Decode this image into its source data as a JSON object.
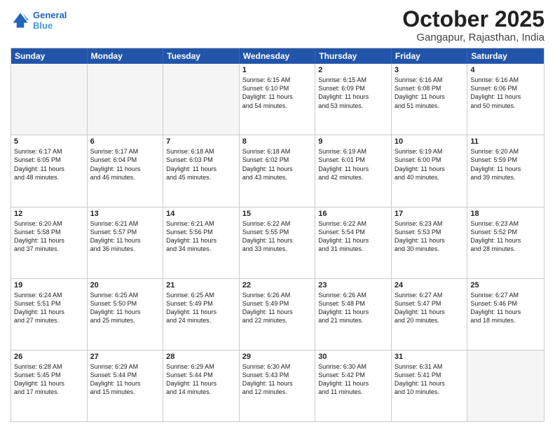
{
  "logo": {
    "line1": "General",
    "line2": "Blue"
  },
  "title": "October 2025",
  "location": "Gangapur, Rajasthan, India",
  "days_header": [
    "Sunday",
    "Monday",
    "Tuesday",
    "Wednesday",
    "Thursday",
    "Friday",
    "Saturday"
  ],
  "weeks": [
    [
      {
        "day": "",
        "info": ""
      },
      {
        "day": "",
        "info": ""
      },
      {
        "day": "",
        "info": ""
      },
      {
        "day": "1",
        "info": "Sunrise: 6:15 AM\nSunset: 6:10 PM\nDaylight: 11 hours\nand 54 minutes."
      },
      {
        "day": "2",
        "info": "Sunrise: 6:15 AM\nSunset: 6:09 PM\nDaylight: 11 hours\nand 53 minutes."
      },
      {
        "day": "3",
        "info": "Sunrise: 6:16 AM\nSunset: 6:08 PM\nDaylight: 11 hours\nand 51 minutes."
      },
      {
        "day": "4",
        "info": "Sunrise: 6:16 AM\nSunset: 6:06 PM\nDaylight: 11 hours\nand 50 minutes."
      }
    ],
    [
      {
        "day": "5",
        "info": "Sunrise: 6:17 AM\nSunset: 6:05 PM\nDaylight: 11 hours\nand 48 minutes."
      },
      {
        "day": "6",
        "info": "Sunrise: 6:17 AM\nSunset: 6:04 PM\nDaylight: 11 hours\nand 46 minutes."
      },
      {
        "day": "7",
        "info": "Sunrise: 6:18 AM\nSunset: 6:03 PM\nDaylight: 11 hours\nand 45 minutes."
      },
      {
        "day": "8",
        "info": "Sunrise: 6:18 AM\nSunset: 6:02 PM\nDaylight: 11 hours\nand 43 minutes."
      },
      {
        "day": "9",
        "info": "Sunrise: 6:19 AM\nSunset: 6:01 PM\nDaylight: 11 hours\nand 42 minutes."
      },
      {
        "day": "10",
        "info": "Sunrise: 6:19 AM\nSunset: 6:00 PM\nDaylight: 11 hours\nand 40 minutes."
      },
      {
        "day": "11",
        "info": "Sunrise: 6:20 AM\nSunset: 5:59 PM\nDaylight: 11 hours\nand 39 minutes."
      }
    ],
    [
      {
        "day": "12",
        "info": "Sunrise: 6:20 AM\nSunset: 5:58 PM\nDaylight: 11 hours\nand 37 minutes."
      },
      {
        "day": "13",
        "info": "Sunrise: 6:21 AM\nSunset: 5:57 PM\nDaylight: 11 hours\nand 36 minutes."
      },
      {
        "day": "14",
        "info": "Sunrise: 6:21 AM\nSunset: 5:56 PM\nDaylight: 11 hours\nand 34 minutes."
      },
      {
        "day": "15",
        "info": "Sunrise: 6:22 AM\nSunset: 5:55 PM\nDaylight: 11 hours\nand 33 minutes."
      },
      {
        "day": "16",
        "info": "Sunrise: 6:22 AM\nSunset: 5:54 PM\nDaylight: 11 hours\nand 31 minutes."
      },
      {
        "day": "17",
        "info": "Sunrise: 6:23 AM\nSunset: 5:53 PM\nDaylight: 11 hours\nand 30 minutes."
      },
      {
        "day": "18",
        "info": "Sunrise: 6:23 AM\nSunset: 5:52 PM\nDaylight: 11 hours\nand 28 minutes."
      }
    ],
    [
      {
        "day": "19",
        "info": "Sunrise: 6:24 AM\nSunset: 5:51 PM\nDaylight: 11 hours\nand 27 minutes."
      },
      {
        "day": "20",
        "info": "Sunrise: 6:25 AM\nSunset: 5:50 PM\nDaylight: 11 hours\nand 25 minutes."
      },
      {
        "day": "21",
        "info": "Sunrise: 6:25 AM\nSunset: 5:49 PM\nDaylight: 11 hours\nand 24 minutes."
      },
      {
        "day": "22",
        "info": "Sunrise: 6:26 AM\nSunset: 5:49 PM\nDaylight: 11 hours\nand 22 minutes."
      },
      {
        "day": "23",
        "info": "Sunrise: 6:26 AM\nSunset: 5:48 PM\nDaylight: 11 hours\nand 21 minutes."
      },
      {
        "day": "24",
        "info": "Sunrise: 6:27 AM\nSunset: 5:47 PM\nDaylight: 11 hours\nand 20 minutes."
      },
      {
        "day": "25",
        "info": "Sunrise: 6:27 AM\nSunset: 5:46 PM\nDaylight: 11 hours\nand 18 minutes."
      }
    ],
    [
      {
        "day": "26",
        "info": "Sunrise: 6:28 AM\nSunset: 5:45 PM\nDaylight: 11 hours\nand 17 minutes."
      },
      {
        "day": "27",
        "info": "Sunrise: 6:29 AM\nSunset: 5:44 PM\nDaylight: 11 hours\nand 15 minutes."
      },
      {
        "day": "28",
        "info": "Sunrise: 6:29 AM\nSunset: 5:44 PM\nDaylight: 11 hours\nand 14 minutes."
      },
      {
        "day": "29",
        "info": "Sunrise: 6:30 AM\nSunset: 5:43 PM\nDaylight: 11 hours\nand 12 minutes."
      },
      {
        "day": "30",
        "info": "Sunrise: 6:30 AM\nSunset: 5:42 PM\nDaylight: 11 hours\nand 11 minutes."
      },
      {
        "day": "31",
        "info": "Sunrise: 6:31 AM\nSunset: 5:41 PM\nDaylight: 11 hours\nand 10 minutes."
      },
      {
        "day": "",
        "info": ""
      }
    ]
  ]
}
